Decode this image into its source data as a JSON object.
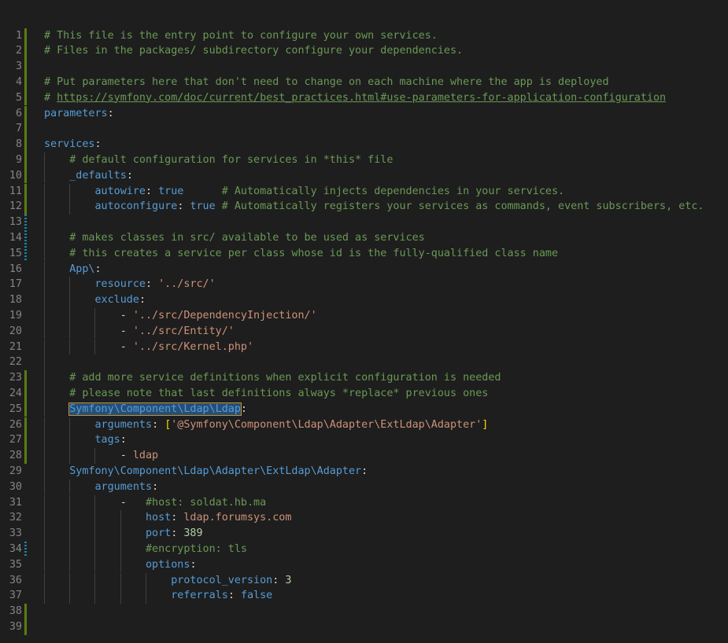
{
  "editor": {
    "language": "yaml",
    "colors": {
      "background": "#1e1e1e",
      "comment": "#6a9955",
      "key": "#569cd6",
      "string": "#ce9178",
      "number": "#b5cea8",
      "bracket": "#ffd700",
      "line_number": "#858585",
      "added_marker": "#587c0c",
      "modified_marker": "#1b81a8"
    },
    "lines": [
      {
        "number": "1",
        "text": "# This file is the entry point to configure your own services."
      },
      {
        "number": "2",
        "text": "# Files in the packages/ subdirectory configure your dependencies."
      },
      {
        "number": "3",
        "text": ""
      },
      {
        "number": "4",
        "text": "# Put parameters here that don't need to change on each machine where the app is deployed"
      },
      {
        "number": "5",
        "text": "# https://symfony.com/doc/current/best_practices.html#use-parameters-for-application-configuration"
      },
      {
        "number": "6",
        "text": "parameters:"
      },
      {
        "number": "7",
        "text": ""
      },
      {
        "number": "8",
        "text": "services:"
      },
      {
        "number": "9",
        "text": "    # default configuration for services in *this* file"
      },
      {
        "number": "10",
        "text": "    _defaults:"
      },
      {
        "number": "11",
        "text": "        autowire: true      # Automatically injects dependencies in your services."
      },
      {
        "number": "12",
        "text": "        autoconfigure: true # Automatically registers your services as commands, event subscribers, etc."
      },
      {
        "number": "13",
        "text": ""
      },
      {
        "number": "14",
        "text": "    # makes classes in src/ available to be used as services"
      },
      {
        "number": "15",
        "text": "    # this creates a service per class whose id is the fully-qualified class name"
      },
      {
        "number": "16",
        "text": "    App\\:"
      },
      {
        "number": "17",
        "text": "        resource: '../src/'"
      },
      {
        "number": "18",
        "text": "        exclude:"
      },
      {
        "number": "19",
        "text": "            - '../src/DependencyInjection/'"
      },
      {
        "number": "20",
        "text": "            - '../src/Entity/'"
      },
      {
        "number": "21",
        "text": "            - '../src/Kernel.php'"
      },
      {
        "number": "22",
        "text": ""
      },
      {
        "number": "23",
        "text": "    # add more service definitions when explicit configuration is needed"
      },
      {
        "number": "24",
        "text": "    # please note that last definitions always *replace* previous ones"
      },
      {
        "number": "25",
        "text": "    Symfony\\Component\\Ldap\\Ldap:"
      },
      {
        "number": "26",
        "text": "        arguments: ['@Symfony\\Component\\Ldap\\Adapter\\ExtLdap\\Adapter']"
      },
      {
        "number": "27",
        "text": "        tags:"
      },
      {
        "number": "28",
        "text": "            - ldap"
      },
      {
        "number": "29",
        "text": "    Symfony\\Component\\Ldap\\Adapter\\ExtLdap\\Adapter:"
      },
      {
        "number": "30",
        "text": "        arguments:"
      },
      {
        "number": "31",
        "text": "            -   #host: soldat.hb.ma"
      },
      {
        "number": "32",
        "text": "                host: ldap.forumsys.com"
      },
      {
        "number": "33",
        "text": "                port: 389"
      },
      {
        "number": "34",
        "text": "                #encryption: tls"
      },
      {
        "number": "35",
        "text": "                options:"
      },
      {
        "number": "36",
        "text": "                    protocol_version: 3"
      },
      {
        "number": "37",
        "text": "                    referrals: false"
      },
      {
        "number": "38",
        "text": ""
      },
      {
        "number": "39",
        "text": ""
      }
    ]
  }
}
